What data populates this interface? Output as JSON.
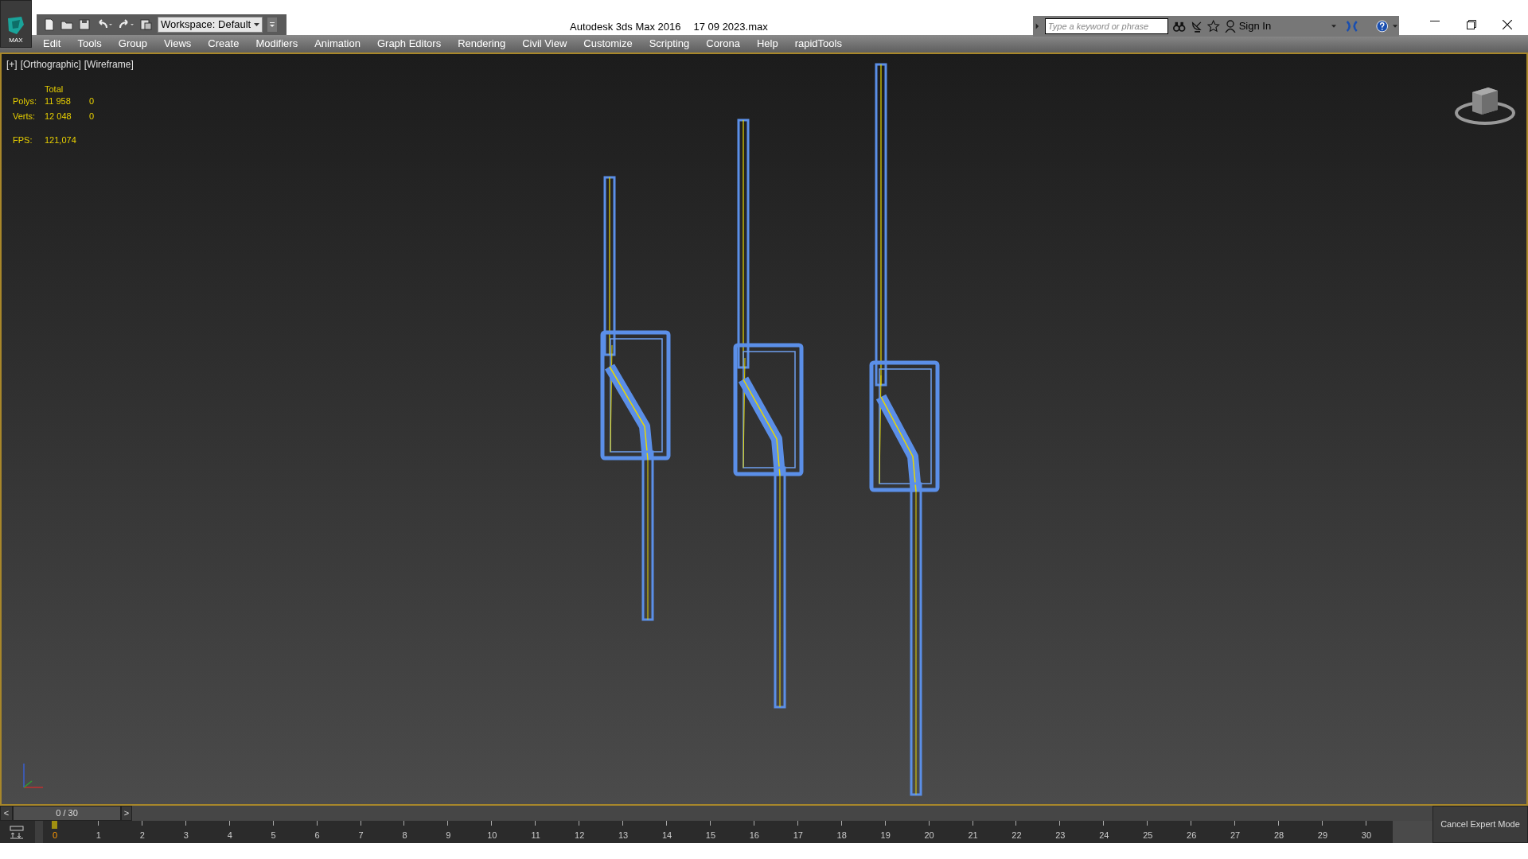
{
  "title_bar": {
    "app_button": "MAX",
    "workspace": "Workspace: Default",
    "title": "Autodesk 3ds Max 2016",
    "filename": "17 09 2023.max",
    "search": {
      "placeholder": "Type a keyword or phrase"
    },
    "sign_in": "Sign In"
  },
  "menu": [
    "Edit",
    "Tools",
    "Group",
    "Views",
    "Create",
    "Modifiers",
    "Animation",
    "Graph Editors",
    "Rendering",
    "Civil View",
    "Customize",
    "Scripting",
    "Corona",
    "Help",
    "rapidTools"
  ],
  "viewport": {
    "labels": [
      "[+]",
      "[Orthographic]",
      "[Wireframe]"
    ],
    "stats_header": "Total",
    "stats": [
      {
        "label": "Polys:",
        "total": "11 958",
        "selected": "0"
      },
      {
        "label": "Verts:",
        "total": "12 048",
        "selected": "0"
      }
    ],
    "fps": {
      "label": "FPS:",
      "value": "121,074"
    }
  },
  "time_slider": {
    "prev": "<",
    "position": "0 / 30",
    "next": ">"
  },
  "track_bar": {
    "ticks": [
      {
        "label": "0",
        "selected": true
      },
      {
        "label": "1",
        "selected": false
      },
      {
        "label": "2",
        "selected": false
      },
      {
        "label": "3",
        "selected": false
      },
      {
        "label": "4",
        "selected": false
      },
      {
        "label": "5",
        "selected": false
      },
      {
        "label": "6",
        "selected": false
      },
      {
        "label": "7",
        "selected": false
      },
      {
        "label": "8",
        "selected": false
      },
      {
        "label": "9",
        "selected": false
      },
      {
        "label": "10",
        "selected": false
      },
      {
        "label": "11",
        "selected": false
      },
      {
        "label": "12",
        "selected": false
      },
      {
        "label": "13",
        "selected": false
      },
      {
        "label": "14",
        "selected": false
      },
      {
        "label": "15",
        "selected": false
      },
      {
        "label": "16",
        "selected": false
      },
      {
        "label": "17",
        "selected": false
      },
      {
        "label": "18",
        "selected": false
      },
      {
        "label": "19",
        "selected": false
      },
      {
        "label": "20",
        "selected": false
      },
      {
        "label": "21",
        "selected": false
      },
      {
        "label": "22",
        "selected": false
      },
      {
        "label": "23",
        "selected": false
      },
      {
        "label": "24",
        "selected": false
      },
      {
        "label": "25",
        "selected": false
      },
      {
        "label": "26",
        "selected": false
      },
      {
        "label": "27",
        "selected": false
      },
      {
        "label": "28",
        "selected": false
      },
      {
        "label": "29",
        "selected": false
      },
      {
        "label": "30",
        "selected": false
      }
    ]
  },
  "expert_button": "Cancel Expert Mode"
}
